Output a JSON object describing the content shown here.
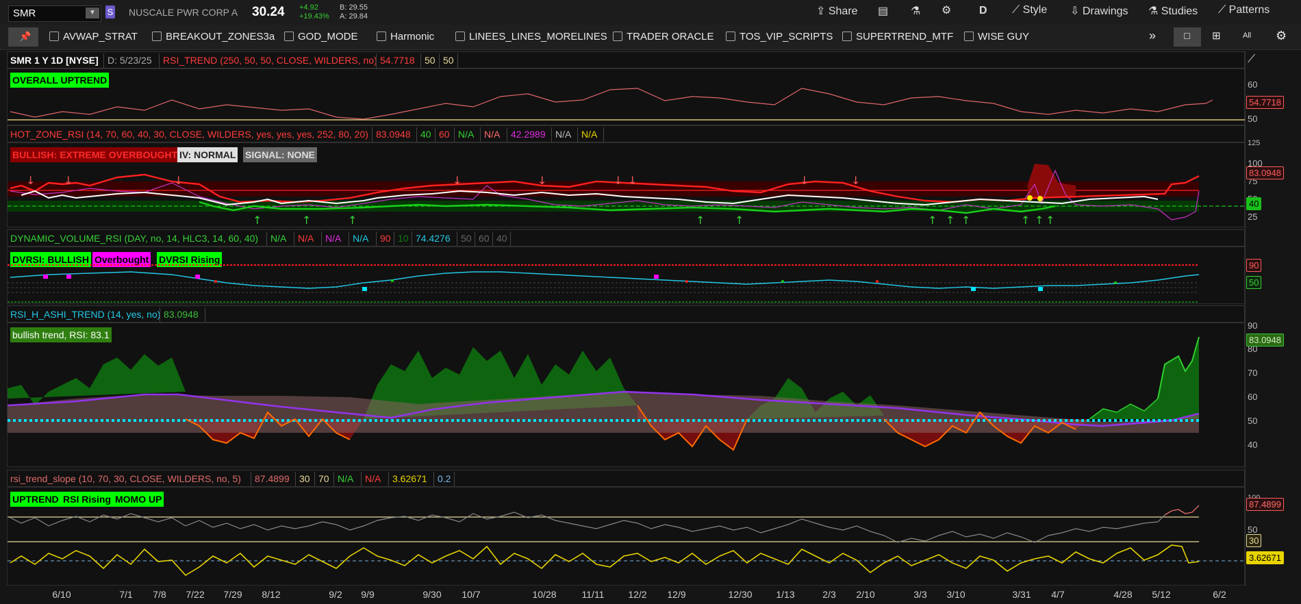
{
  "top": {
    "symbol": "SMR",
    "account_badge": "S",
    "company": "NUSCALE PWR CORP A",
    "price": "30.24",
    "change": "+4.92",
    "change_pct": "+19.43%",
    "bid": "B: 29.55",
    "ask": "A: 29.84",
    "share": "Share",
    "timeframe": "D",
    "style": "Style",
    "drawings": "Drawings",
    "studies": "Studies",
    "patterns": "Patterns"
  },
  "toolbar": {
    "items": [
      "AVWAP_STRAT",
      "BREAKOUT_ZONES3a",
      "GOD_MODE",
      "Harmonic",
      "LINEES_LINES_MORELINES",
      "TRADER ORACLE",
      "TOS_VIP_SCRIPTS",
      "SUPERTREND_MTF",
      "WISE GUY"
    ],
    "more": "»",
    "all": "All"
  },
  "pane1": {
    "symbol_info": "SMR 1 Y 1D [NYSE]",
    "date": "D: 5/23/25",
    "study": "RSI_TREND (250, 50, 50, CLOSE, WILDERS, no)",
    "v1": "54.7718",
    "v2": "50",
    "v3": "50",
    "label": "OVERALL UPTREND",
    "ticks": [
      "60",
      "50"
    ],
    "badge": "54.7718"
  },
  "pane2": {
    "study": "HOT_ZONE_RSI (14, 70, 60, 40, 30, CLOSE, WILDERS, yes, yes, yes, 252, 80, 20)",
    "vals": [
      "83.0948",
      "40",
      "60",
      "N/A",
      "N/A",
      "42.2989",
      "N/A",
      "N/A"
    ],
    "labels": [
      "BULLISH: EXTREME OVERBOUGHT",
      "IV: NORMAL",
      "SIGNAL: NONE"
    ],
    "ticks": [
      "125",
      "100",
      "75",
      "50",
      "25"
    ],
    "badge_top": "83.0948",
    "badge_bot": "40"
  },
  "pane3": {
    "study": "DYNAMIC_VOLUME_RSI (DAY, no, 14, HLC3, 14, 60, 40)",
    "vals": [
      "N/A",
      "N/A",
      "N/A",
      "N/A",
      "90",
      "10",
      "74.4276",
      "50",
      "60",
      "40"
    ],
    "labels": [
      "DVRSI: BULLISH",
      "Overbought",
      "DVRSI Rising"
    ],
    "badge_top": "90",
    "badge_bot": "50"
  },
  "pane4": {
    "study": "RSI_H_ASHI_TREND (14, yes, no)",
    "val": "83.0948",
    "label": "bullish trend, RSI: 83.1",
    "ticks": [
      "90",
      "80",
      "70",
      "60",
      "50",
      "40"
    ],
    "badge": "83.0948"
  },
  "pane5": {
    "study": "rsi_trend_slope (10, 70, 30, CLOSE, WILDERS, no, 5)",
    "vals": [
      "87.4899",
      "30",
      "70",
      "N/A",
      "N/A",
      "3.62671",
      "0.2"
    ],
    "labels": [
      "UPTREND",
      "RSI Rising",
      "MOMO UP"
    ],
    "ticks": [
      "100",
      "50"
    ],
    "badge_top": "87.4899",
    "badge_mid": "30",
    "badge_bot": "3.62671"
  },
  "dates": [
    "6/10",
    "7/1",
    "7/8",
    "7/22",
    "7/29",
    "8/12",
    "9/2",
    "9/9",
    "9/30",
    "10/7",
    "10/28",
    "11/11",
    "12/2",
    "12/9",
    "12/30",
    "1/13",
    "2/3",
    "2/10",
    "3/3",
    "3/10",
    "3/31",
    "4/7",
    "4/28",
    "5/12",
    "6/2"
  ],
  "colors": {
    "accent": "#00ff00",
    "red": "#ff2a2a",
    "magenta": "#ff00ff",
    "cyan": "#00e5ff",
    "yellow": "#e8d400"
  }
}
